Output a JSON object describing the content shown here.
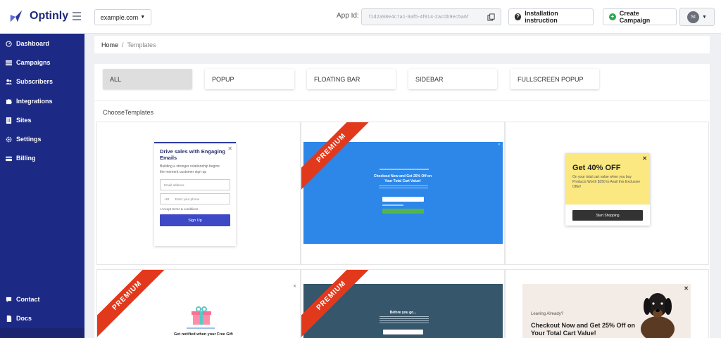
{
  "app": {
    "name": "Optinly"
  },
  "header": {
    "site_select": "example.com",
    "appid_label": "App Id:",
    "appid_value": "f1d2a98e4c7a1-9af5-4f914-2ac0b9ec5a6f",
    "install_label": "Installation instruction",
    "create_label": "Create Campaign",
    "avatar_initials": "SI"
  },
  "sidebar": {
    "items": [
      {
        "label": "Dashboard",
        "icon": "dashboard-icon"
      },
      {
        "label": "Campaigns",
        "icon": "list-icon"
      },
      {
        "label": "Subscribers",
        "icon": "users-icon"
      },
      {
        "label": "Integrations",
        "icon": "puzzle-icon"
      },
      {
        "label": "Sites",
        "icon": "sites-icon"
      },
      {
        "label": "Settings",
        "icon": "gear-icon"
      },
      {
        "label": "Billing",
        "icon": "billing-icon"
      }
    ],
    "footer_items": [
      {
        "label": "Contact",
        "icon": "chat-icon"
      },
      {
        "label": "Docs",
        "icon": "doc-icon"
      }
    ]
  },
  "breadcrumb": {
    "home": "Home",
    "separator": "/",
    "current": "Templates"
  },
  "tabs": [
    "ALL",
    "POPUP",
    "FLOATING BAR",
    "SIDEBAR",
    "FULLSCREEN POPUP"
  ],
  "choose_label": "ChooseTemplates",
  "premium_label": "PREMIUM",
  "templates": {
    "t1": {
      "title": "Drive sales with Engaging Emails",
      "text": "Building a stronger relationship begins the moment customer sign-up",
      "email_placeholder": "Email address",
      "phone_code": "+91",
      "phone_placeholder": "Enter your phone",
      "checkbox": "I Accept terms & conditions",
      "button": "Sign Up"
    },
    "t2": {
      "title": "Checkout Now and Get 25% Off on Your Total Cart Value!"
    },
    "t3": {
      "title": "Get 40% OFF",
      "text": "On your total cart value when you buy Products Worth $350 to Avail this Exclusive Offer!",
      "button": "Start Shopping"
    },
    "t4": {
      "title": "Get notified when your Free Gift"
    },
    "t5": {
      "title": "Before you go..."
    },
    "t6": {
      "pretitle": "Leaving Already?",
      "title": "Checkout Now and Get 25% Off on Your Total Cart Value!"
    }
  },
  "colors": {
    "sidebar": "#1c2a85",
    "brand": "#1d2a7a",
    "premium": "#e2391d",
    "create_icon": "#2fa84f",
    "t1_button": "#3d49c5",
    "t2_bg": "#2c87e9",
    "t3_bg": "#fbe880",
    "t5_bg": "#35566b"
  }
}
